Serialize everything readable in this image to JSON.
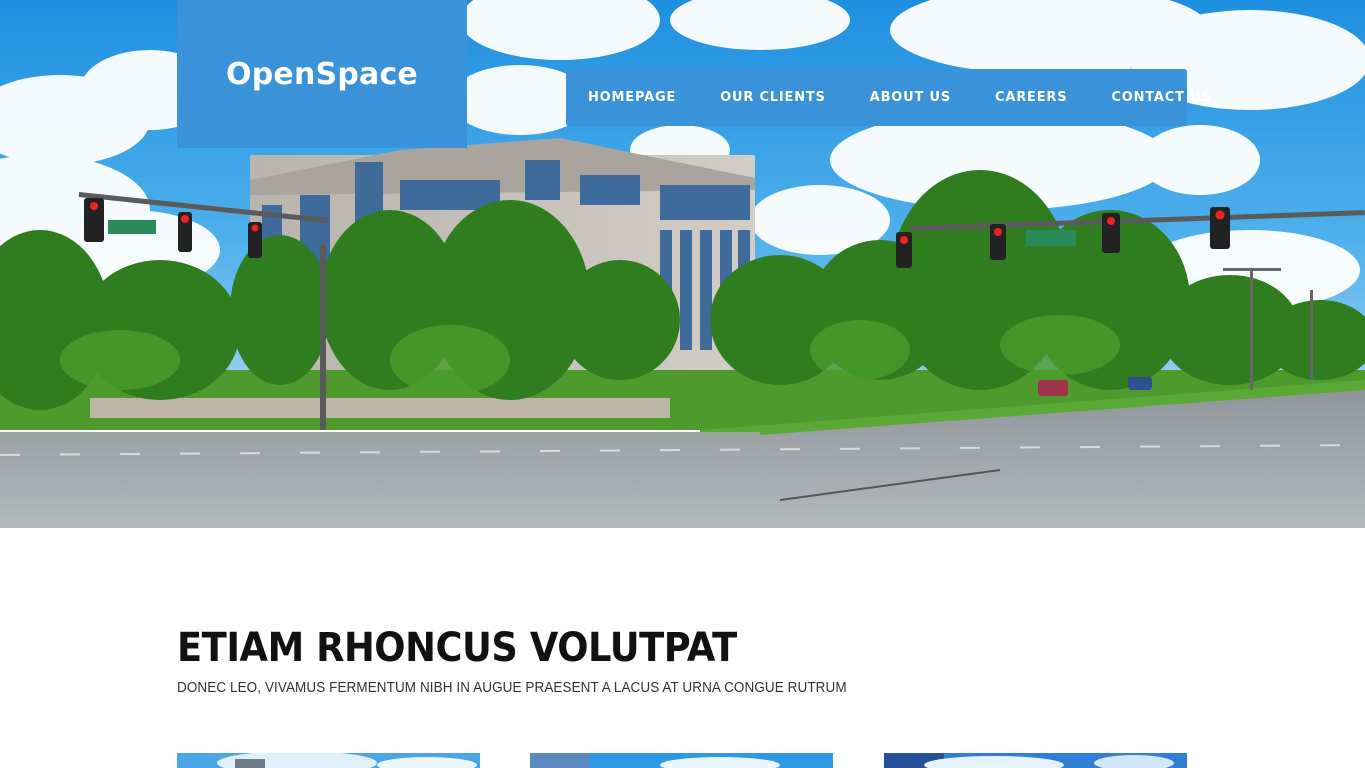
{
  "site": {
    "logo_text": "OpenSpace"
  },
  "nav": {
    "items": [
      {
        "label": "HOMEPAGE"
      },
      {
        "label": "OUR CLIENTS"
      },
      {
        "label": "ABOUT US"
      },
      {
        "label": "CAREERS"
      },
      {
        "label": "CONTACT US"
      }
    ]
  },
  "intro": {
    "headline": "ETIAM RHONCUS VOLUTPAT",
    "subheadline": "DONEC LEO, VIVAMUS FERMENTUM NIBH IN AUGUE PRAESENT A LACUS AT URNA CONGUE RUTRUM"
  },
  "colors": {
    "accent": "#3a92d8",
    "heading": "#111111",
    "subtext": "#333333"
  }
}
